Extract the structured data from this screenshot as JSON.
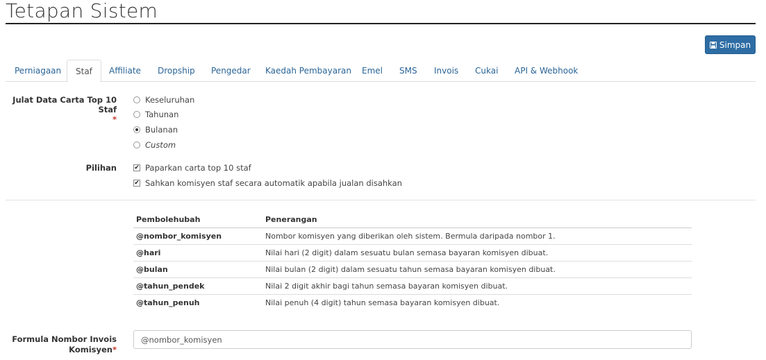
{
  "header": {
    "title": "Tetapan Sistem"
  },
  "toolbar": {
    "save_label": "Simpan"
  },
  "tabs": [
    {
      "label": "Perniagaan",
      "active": false
    },
    {
      "label": "Staf",
      "active": true
    },
    {
      "label": "Affiliate",
      "active": false
    },
    {
      "label": "Dropship",
      "active": false
    },
    {
      "label": "Pengedar",
      "active": false
    },
    {
      "label": "Kaedah Pembayaran",
      "active": false
    },
    {
      "label": "Emel",
      "active": false
    },
    {
      "label": "SMS",
      "active": false
    },
    {
      "label": "Invois",
      "active": false
    },
    {
      "label": "Cukai",
      "active": false
    },
    {
      "label": "API & Webhook",
      "active": false
    }
  ],
  "chart_range": {
    "label": "Julat Data Carta Top 10 Staf",
    "required_mark": "*",
    "options": [
      {
        "label": "Keseluruhan",
        "checked": false
      },
      {
        "label": "Tahunan",
        "checked": false
      },
      {
        "label": "Bulanan",
        "checked": true
      },
      {
        "label": "Custom",
        "checked": false
      }
    ]
  },
  "options": {
    "label": "Pilihan",
    "items": [
      {
        "label": "Paparkan carta top 10 staf",
        "checked": true
      },
      {
        "label": "Sahkan komisyen staf secara automatik apabila jualan disahkan",
        "checked": true
      }
    ]
  },
  "variables_table": {
    "headers": [
      "Pembolehubah",
      "Penerangan"
    ],
    "rows": [
      [
        "@nombor_komisyen",
        "Nombor komisyen yang diberikan oleh sistem. Bermula daripada nombor 1."
      ],
      [
        "@hari",
        "Nilai hari (2 digit) dalam sesuatu bulan semasa bayaran komisyen dibuat."
      ],
      [
        "@bulan",
        "Nilai bulan (2 digit) dalam sesuatu tahun semasa bayaran komisyen dibuat."
      ],
      [
        "@tahun_pendek",
        "Nilai 2 digit akhir bagi tahun semasa bayaran komisyen dibuat."
      ],
      [
        "@tahun_penuh",
        "Nilai penuh (4 digit) tahun semasa bayaran komisyen dibuat."
      ]
    ]
  },
  "formula": {
    "label_line1": "Formula Nombor Invois",
    "label_line2": "Komisyen",
    "required_mark": "*",
    "value": "@nombor_komisyen"
  },
  "colors": {
    "accent": "#2e6da4",
    "tab_link": "#2a6496",
    "required": "#c0392b"
  }
}
